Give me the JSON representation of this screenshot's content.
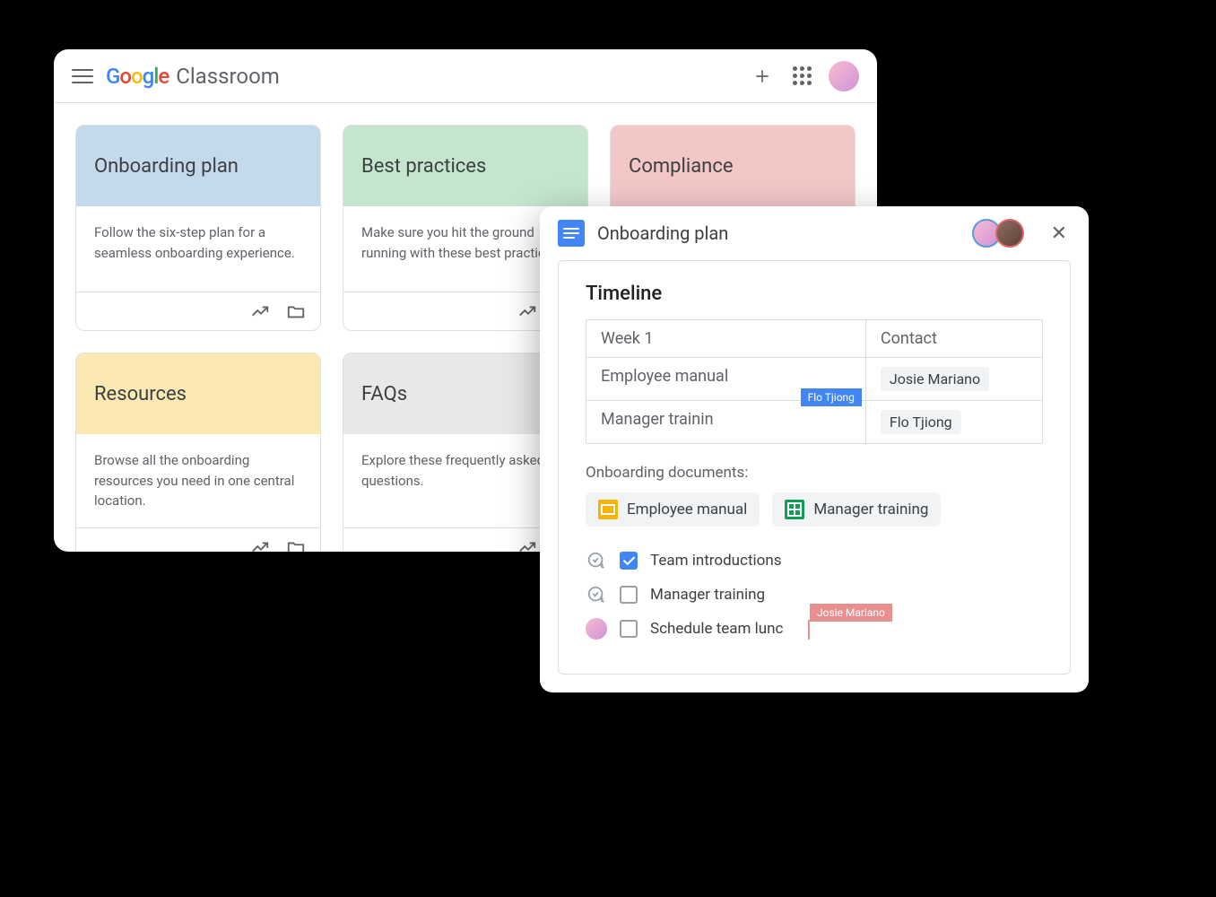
{
  "header": {
    "product": "Classroom",
    "logo_letters": [
      "G",
      "o",
      "o",
      "g",
      "l",
      "e"
    ]
  },
  "cards": [
    {
      "title": "Onboarding plan",
      "desc": "Follow the six-step plan for a seamless onboarding experience.",
      "bg": "bg-blue"
    },
    {
      "title": "Best practices",
      "desc": "Make sure you hit the ground running with these best practices.",
      "bg": "bg-green"
    },
    {
      "title": "Compliance",
      "desc": "",
      "bg": "bg-pink"
    },
    {
      "title": "Resources",
      "desc": "Browse all the onboarding resources you need in one central location.",
      "bg": "bg-yellow"
    },
    {
      "title": "FAQs",
      "desc": "Explore these frequently asked questions.",
      "bg": "bg-gray"
    }
  ],
  "docs": {
    "title": "Onboarding plan",
    "timeline_heading": "Timeline",
    "table": {
      "headers": [
        "Week 1",
        "Contact"
      ],
      "rows": [
        {
          "item": "Employee manual",
          "contact": "Josie Mariano"
        },
        {
          "item": "Manager trainin",
          "contact": "Flo Tjiong"
        }
      ]
    },
    "cursor_blue_name": "Flo Tjiong",
    "section_label": "Onboarding documents:",
    "doc_chips": [
      {
        "label": "Employee manual",
        "icon": "slides"
      },
      {
        "label": "Manager training",
        "icon": "sheets"
      }
    ],
    "checklist": [
      {
        "label": "Team introductions",
        "checked": true,
        "prefix": "assign"
      },
      {
        "label": "Manager training",
        "checked": false,
        "prefix": "assign"
      },
      {
        "label": "Schedule team lunc",
        "checked": false,
        "prefix": "avatar"
      }
    ],
    "cursor_red_name": "Josie Mariano"
  }
}
